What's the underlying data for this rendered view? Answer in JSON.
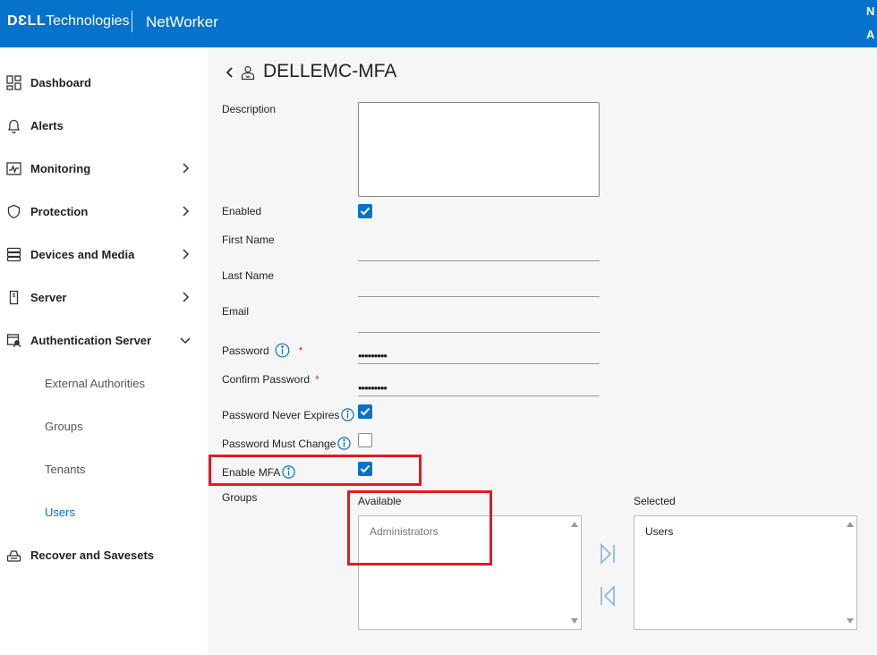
{
  "header": {
    "brand_bold": "DƐLL",
    "brand_light": "Technologies",
    "product": "NetWorker",
    "right_line1": "N",
    "right_line2": "A"
  },
  "sidebar": {
    "items": [
      {
        "label": "Dashboard",
        "icon": "dashboard-icon",
        "chevron": "none"
      },
      {
        "label": "Alerts",
        "icon": "bell-icon",
        "chevron": "none"
      },
      {
        "label": "Monitoring",
        "icon": "monitoring-icon",
        "chevron": "right"
      },
      {
        "label": "Protection",
        "icon": "shield-icon",
        "chevron": "right"
      },
      {
        "label": "Devices and Media",
        "icon": "storage-icon",
        "chevron": "right"
      },
      {
        "label": "Server",
        "icon": "server-icon",
        "chevron": "right"
      },
      {
        "label": "Authentication Server",
        "icon": "auth-server-icon",
        "chevron": "down"
      },
      {
        "label": "Recover and Savesets",
        "icon": "recover-icon",
        "chevron": "none"
      }
    ],
    "sub_items": [
      {
        "label": "External Authorities",
        "active": false
      },
      {
        "label": "Groups",
        "active": false
      },
      {
        "label": "Tenants",
        "active": false
      },
      {
        "label": "Users",
        "active": true
      }
    ]
  },
  "main": {
    "title": "DELLEMC-MFA",
    "fields": {
      "description": {
        "label": "Description",
        "value": ""
      },
      "enabled": {
        "label": "Enabled",
        "checked": true
      },
      "first_name": {
        "label": "First Name",
        "value": ""
      },
      "last_name": {
        "label": "Last Name",
        "value": ""
      },
      "email": {
        "label": "Email",
        "value": ""
      },
      "password": {
        "label": "Password",
        "required_mark": "*",
        "value": "•••••••••"
      },
      "confirm_password": {
        "label": "Confirm Password",
        "required_mark": "*",
        "value": "•••••••••"
      },
      "password_never_expires": {
        "label": "Password Never Expires",
        "checked": true
      },
      "password_must_change": {
        "label": "Password Must Change",
        "checked": false
      },
      "enable_mfa": {
        "label": "Enable MFA",
        "checked": true
      }
    },
    "groups": {
      "label": "Groups",
      "available_label": "Available",
      "selected_label": "Selected",
      "available": [
        "Administrators"
      ],
      "selected": [
        "Users"
      ]
    }
  },
  "colors": {
    "brand_blue": "#0672cb",
    "highlight_red": "#e01b24",
    "required_red": "#c8371e",
    "move_button": "#7fb6e6"
  }
}
